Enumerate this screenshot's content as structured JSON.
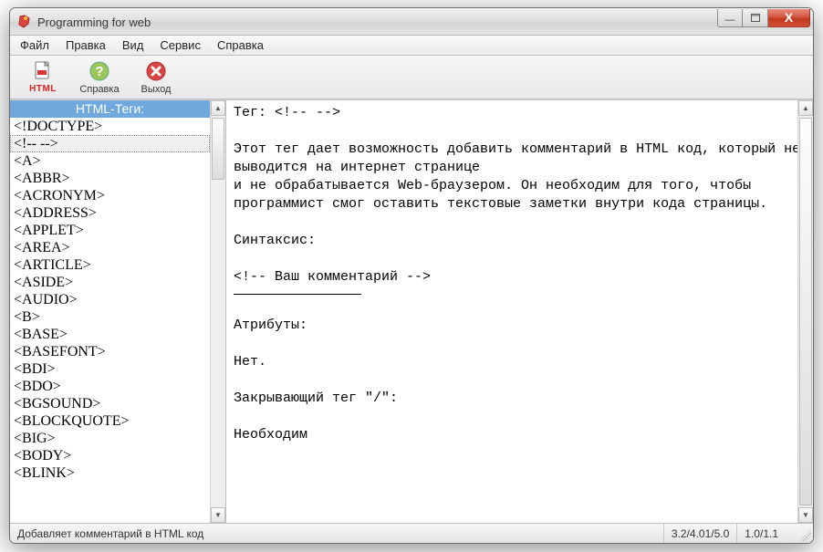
{
  "window": {
    "title": "Programming for web"
  },
  "menu": {
    "items": [
      "Файл",
      "Правка",
      "Вид",
      "Сервис",
      "Справка"
    ]
  },
  "toolbar": {
    "html": {
      "label": "HTML",
      "icon": "html-file-icon"
    },
    "help": {
      "label": "Справка",
      "icon": "help-icon"
    },
    "exit": {
      "label": "Выход",
      "icon": "exit-icon"
    }
  },
  "sidebar": {
    "header": "HTML-Теги:",
    "selected_index": 1,
    "items": [
      "<!DOCTYPE>",
      "<!-- -->",
      "<A>",
      "<ABBR>",
      "<ACRONYM>",
      "<ADDRESS>",
      "<APPLET>",
      "<AREA>",
      "<ARTICLE>",
      "<ASIDE>",
      "<AUDIO>",
      "<B>",
      "<BASE>",
      "<BASEFONT>",
      "<BDI>",
      "<BDO>",
      "<BGSOUND>",
      "<BLOCKQUOTE>",
      "<BIG>",
      "<BODY>",
      "<BLINK>"
    ]
  },
  "content": {
    "tag_line_prefix": "Тег: ",
    "tag_value": "<!-- -->",
    "desc1": "Этот тег дает возможность добавить комментарий в HTML код, который не выводится на интернет странице",
    "desc2": "и не обрабатывается Web-браузером. Он необходим для того, чтобы программист смог оставить текстовые заметки внутри кода страницы.",
    "syntax_label": "Синтаксис:",
    "syntax_example": "<!-- Ваш комментарий -->",
    "attrs_label": "Атрибуты:",
    "attrs_value": "Нет.",
    "closing_label": "Закрывающий тег \"/\":",
    "closing_value": "Необходим"
  },
  "statusbar": {
    "hint": "Добавляет комментарий в HTML код",
    "versions": "3.2/4.01/5.0",
    "xhtml": "1.0/1.1"
  }
}
